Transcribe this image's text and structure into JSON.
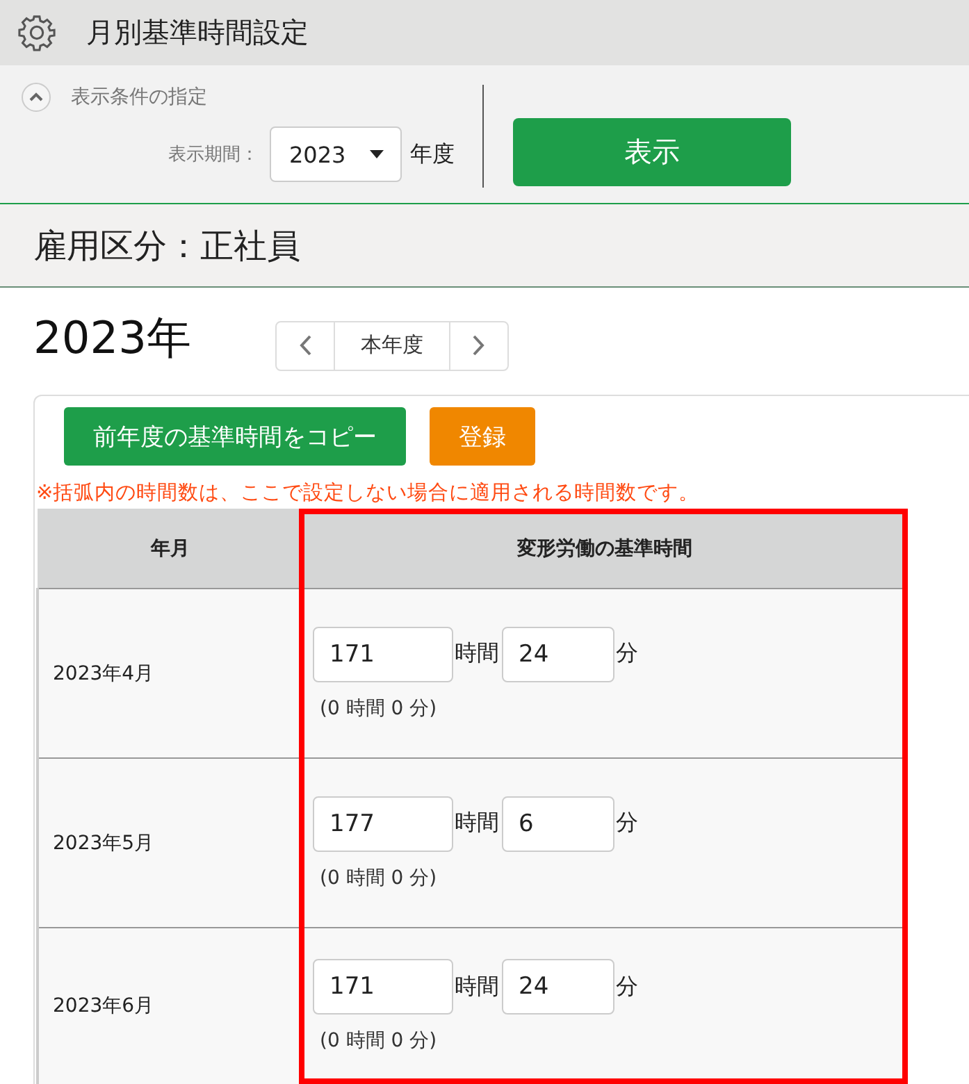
{
  "header": {
    "title": "月別基準時間設定"
  },
  "conditions": {
    "label": "表示条件の指定",
    "expanded": true,
    "period_label": "表示期間：",
    "year": "2023",
    "year_unit": "年度",
    "show_button": "表示"
  },
  "employment": {
    "text": "雇用区分：正社員"
  },
  "year_nav": {
    "title": "2023年",
    "current": "本年度"
  },
  "actions": [
    {
      "label": "前年度の基準時間をコピー",
      "kind": "primary"
    },
    {
      "label": "登録",
      "kind": "warning"
    }
  ],
  "note": "※括弧内の時間数は、ここで設定しない場合に適用される時間数です。",
  "table": {
    "columns": [
      {
        "label": "年月",
        "highlighted": false
      },
      {
        "label": "変形労働の基準時間",
        "highlighted": true
      }
    ],
    "rows": [
      {
        "month": "2023年4月",
        "hours": "171",
        "hours_unit": "時間",
        "minutes": "24",
        "minutes_unit": "分",
        "default": "(0 時間 0 分)"
      },
      {
        "month": "2023年5月",
        "hours": "177",
        "hours_unit": "時間",
        "minutes": "6",
        "minutes_unit": "分",
        "default": "(0 時間 0 分)"
      },
      {
        "month": "2023年6月",
        "hours": "171",
        "hours_unit": "時間",
        "minutes": "24",
        "minutes_unit": "分",
        "default": "(0 時間 0 分)"
      }
    ]
  }
}
